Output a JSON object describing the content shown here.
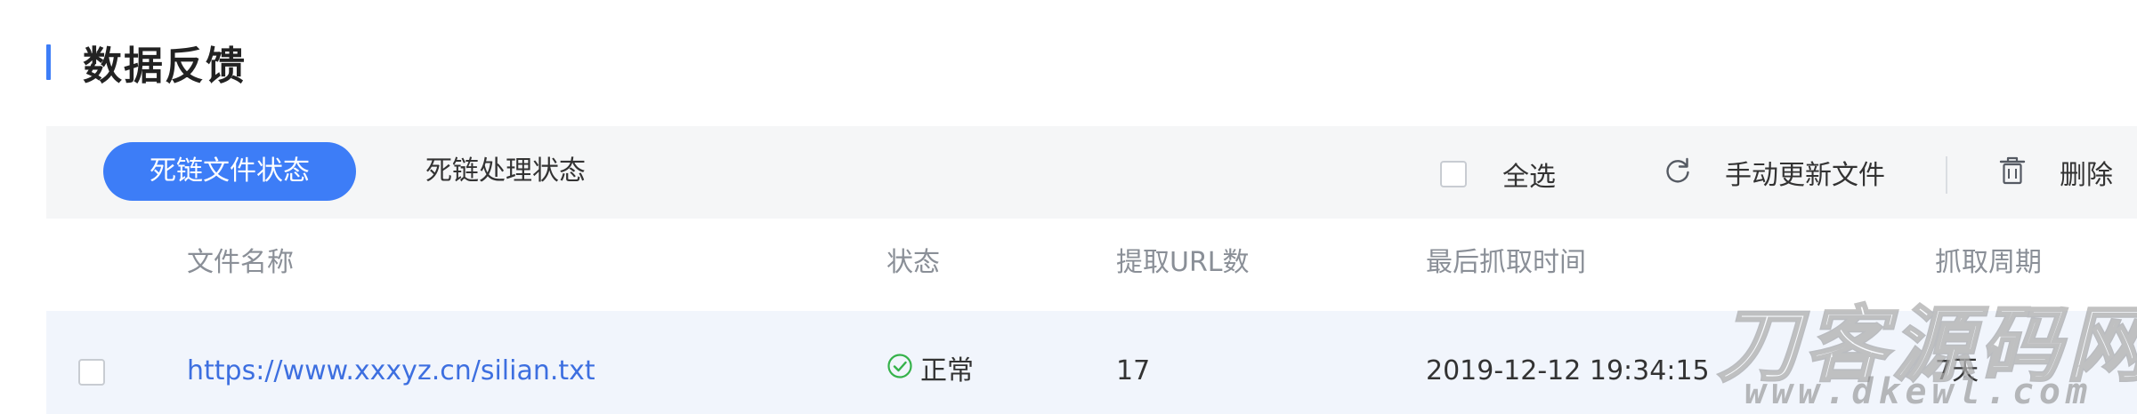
{
  "title": "数据反馈",
  "colors": {
    "accent": "#3d7df7",
    "link": "#3d6fe0",
    "success": "#35b24a",
    "toolbar_bg": "#f5f6f7",
    "row_bg": "#f1f5fc"
  },
  "tabs": [
    {
      "label": "死链文件状态",
      "active": true
    },
    {
      "label": "死链处理状态",
      "active": false
    }
  ],
  "actions": {
    "select_all": "全选",
    "refresh": {
      "label": "手动更新文件",
      "icon": "refresh-icon"
    },
    "delete": {
      "label": "删除",
      "icon": "trash-icon"
    }
  },
  "table": {
    "columns": [
      "文件名称",
      "状态",
      "提取URL数",
      "最后抓取时间",
      "抓取周期"
    ],
    "rows": [
      {
        "file": "https://www.xxxyz.cn/silian.txt",
        "status": "正常",
        "status_icon": "check-circle-icon",
        "url_count": "17",
        "last_fetch": "2019-12-12 19:34:15",
        "period": "7天"
      }
    ]
  },
  "watermark": {
    "title": "刀客源码网",
    "url": "www.dkewl.com"
  }
}
